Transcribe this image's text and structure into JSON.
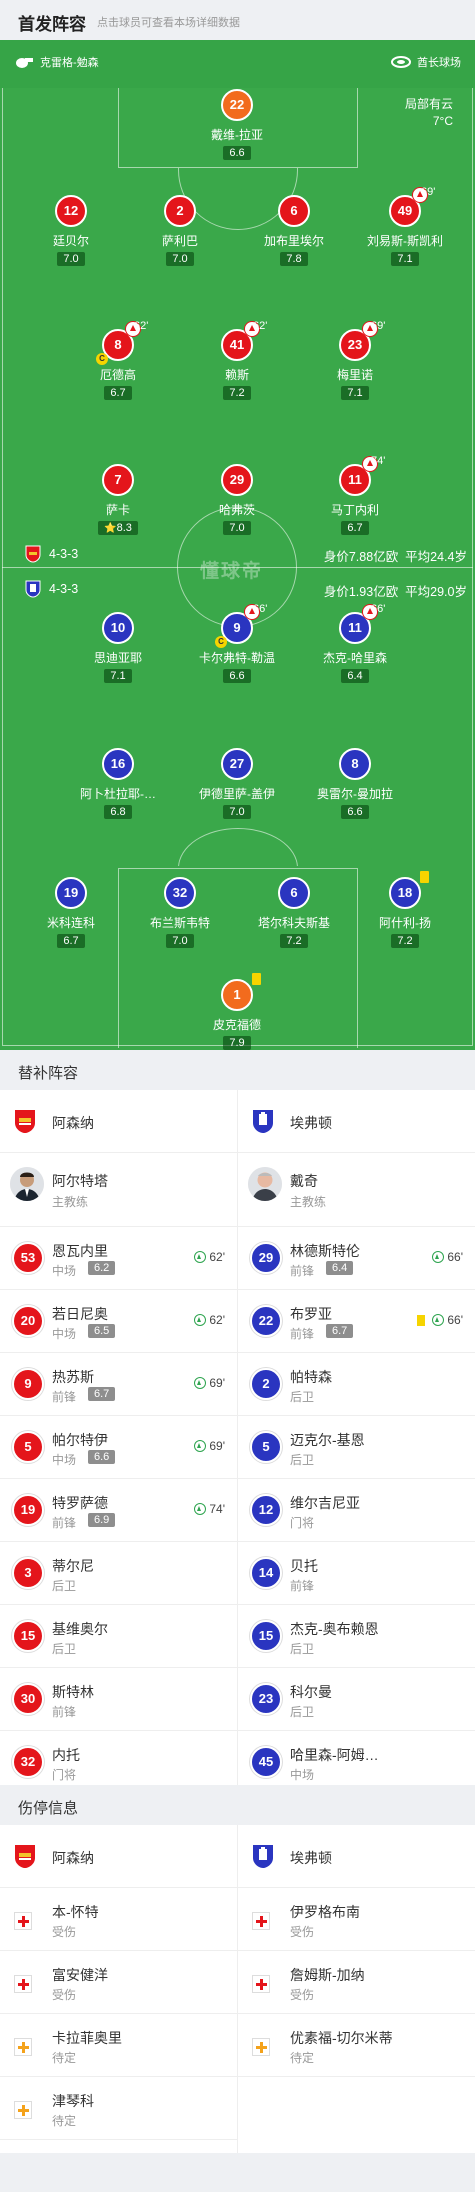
{
  "header": {
    "title": "首发阵容",
    "subtitle": "点击球员可查看本场详细数据"
  },
  "pitch": {
    "referee": "克雷格-勉森",
    "stadium": "酋长球场",
    "weather": "局部有云",
    "temperature": "7°C",
    "watermark": "懂球帝"
  },
  "home": {
    "name": "阿森纳",
    "formation": "4-3-3",
    "value": "身价7.88亿欧",
    "avg_age": "平均24.4岁",
    "color": "#e4151b"
  },
  "away": {
    "name": "埃弗顿",
    "formation": "4-3-3",
    "value": "身价1.93亿欧",
    "avg_age": "平均29.0岁",
    "color": "#2a35c0"
  },
  "home_players": [
    {
      "num": "22",
      "name": "戴维-拉亚",
      "rating": "6.6",
      "gk": true
    },
    {
      "num": "12",
      "name": "廷贝尔",
      "rating": "7.0"
    },
    {
      "num": "2",
      "name": "萨利巴",
      "rating": "7.0"
    },
    {
      "num": "6",
      "name": "加布里埃尔",
      "rating": "7.8"
    },
    {
      "num": "49",
      "name": "刘易斯-斯凯利",
      "rating": "7.1",
      "sub": "69'"
    },
    {
      "num": "8",
      "name": "厄德高",
      "rating": "6.7",
      "sub": "62'",
      "captain": "C"
    },
    {
      "num": "41",
      "name": "赖斯",
      "rating": "7.2",
      "sub": "62'"
    },
    {
      "num": "23",
      "name": "梅里诺",
      "rating": "7.1",
      "sub": "69'"
    },
    {
      "num": "7",
      "name": "萨卡",
      "rating": "8.3",
      "star": "⭐"
    },
    {
      "num": "29",
      "name": "哈弗茨",
      "rating": "7.0"
    },
    {
      "num": "11",
      "name": "马丁内利",
      "rating": "6.7",
      "sub": "74'"
    }
  ],
  "away_players": [
    {
      "num": "10",
      "name": "思迪亚耶",
      "rating": "7.1"
    },
    {
      "num": "9",
      "name": "卡尔弗特-勒温",
      "rating": "6.6",
      "sub": "66'",
      "captain": "C"
    },
    {
      "num": "11",
      "name": "杰克-哈里森",
      "rating": "6.4",
      "sub": "66'"
    },
    {
      "num": "16",
      "name": "阿卜杜拉耶-…",
      "rating": "6.8"
    },
    {
      "num": "27",
      "name": "伊德里萨-盖伊",
      "rating": "7.0"
    },
    {
      "num": "8",
      "name": "奥雷尔-曼加拉",
      "rating": "6.6"
    },
    {
      "num": "19",
      "name": "米科连科",
      "rating": "6.7"
    },
    {
      "num": "32",
      "name": "布兰斯韦特",
      "rating": "7.0"
    },
    {
      "num": "6",
      "name": "塔尔科夫斯基",
      "rating": "7.2"
    },
    {
      "num": "18",
      "name": "阿什利-扬",
      "rating": "7.2",
      "card": "yellow"
    },
    {
      "num": "1",
      "name": "皮克福德",
      "rating": "7.9",
      "gk": true,
      "card": "yellow"
    }
  ],
  "subs": {
    "title": "替补阵容",
    "home_team": "阿森纳",
    "away_team": "埃弗顿",
    "home_coach": {
      "name": "阿尔特塔",
      "role": "主教练"
    },
    "away_coach": {
      "name": "戴奇",
      "role": "主教练"
    },
    "home": [
      {
        "num": "53",
        "name": "恩瓦内里",
        "pos": "中场",
        "rating": "6.2",
        "in": "62'"
      },
      {
        "num": "20",
        "name": "若日尼奥",
        "pos": "中场",
        "rating": "6.5",
        "in": "62'"
      },
      {
        "num": "9",
        "name": "热苏斯",
        "pos": "前锋",
        "rating": "6.7",
        "in": "69'"
      },
      {
        "num": "5",
        "name": "帕尔特伊",
        "pos": "中场",
        "rating": "6.6",
        "in": "69'"
      },
      {
        "num": "19",
        "name": "特罗萨德",
        "pos": "前锋",
        "rating": "6.9",
        "in": "74'"
      },
      {
        "num": "3",
        "name": "蒂尔尼",
        "pos": "后卫"
      },
      {
        "num": "15",
        "name": "基维奥尔",
        "pos": "后卫"
      },
      {
        "num": "30",
        "name": "斯特林",
        "pos": "前锋"
      },
      {
        "num": "32",
        "name": "内托",
        "pos": "门将"
      }
    ],
    "away": [
      {
        "num": "29",
        "name": "林德斯特伦",
        "pos": "前锋",
        "rating": "6.4",
        "in": "66'"
      },
      {
        "num": "22",
        "name": "布罗亚",
        "pos": "前锋",
        "rating": "6.7",
        "in": "66'",
        "card": "yellow"
      },
      {
        "num": "2",
        "name": "帕特森",
        "pos": "后卫"
      },
      {
        "num": "5",
        "name": "迈克尔-基恩",
        "pos": "后卫"
      },
      {
        "num": "12",
        "name": "维尔吉尼亚",
        "pos": "门将"
      },
      {
        "num": "14",
        "name": "贝托",
        "pos": "前锋"
      },
      {
        "num": "15",
        "name": "杰克-奥布赖恩",
        "pos": "后卫"
      },
      {
        "num": "23",
        "name": "科尔曼",
        "pos": "后卫"
      },
      {
        "num": "45",
        "name": "哈里森-阿姆…",
        "pos": "中场"
      }
    ]
  },
  "injuries": {
    "title": "伤停信息",
    "home_team": "阿森纳",
    "away_team": "埃弗顿",
    "home": [
      {
        "name": "本-怀特",
        "status": "受伤",
        "type": "hurt"
      },
      {
        "name": "富安健洋",
        "status": "受伤",
        "type": "hurt"
      },
      {
        "name": "卡拉菲奥里",
        "status": "待定",
        "type": "wait"
      },
      {
        "name": "津琴科",
        "status": "待定",
        "type": "wait"
      }
    ],
    "away": [
      {
        "name": "伊罗格布南",
        "status": "受伤",
        "type": "hurt"
      },
      {
        "name": "詹姆斯-加纳",
        "status": "受伤",
        "type": "hurt"
      },
      {
        "name": "优素福-切尔米蒂",
        "status": "待定",
        "type": "wait"
      }
    ]
  }
}
